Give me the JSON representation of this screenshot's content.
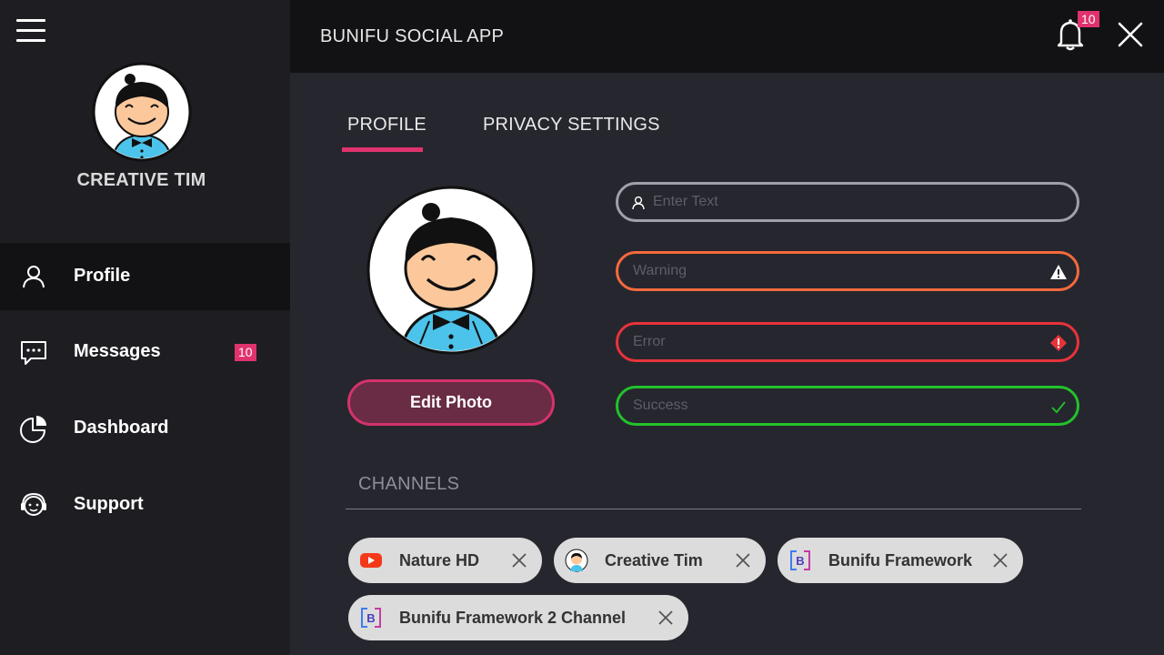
{
  "app": {
    "title": "BUNIFU SOCIAL APP"
  },
  "sidebar": {
    "username": "CREATIVE TIM",
    "items": [
      {
        "label": "Profile",
        "icon": "user-icon",
        "active": true
      },
      {
        "label": "Messages",
        "icon": "chat-icon",
        "badge": "10"
      },
      {
        "label": "Dashboard",
        "icon": "pie-chart-icon"
      },
      {
        "label": "Support",
        "icon": "support-icon"
      }
    ]
  },
  "header": {
    "notifications_badge": "10"
  },
  "tabs": [
    {
      "label": "PROFILE",
      "active": true
    },
    {
      "label": "PRIVACY SETTINGS",
      "active": false
    }
  ],
  "profile": {
    "edit_photo_label": "Edit Photo"
  },
  "form": {
    "default_placeholder": "Enter Text",
    "warning_placeholder": "Warning",
    "error_placeholder": "Error",
    "success_placeholder": "Success"
  },
  "channels": {
    "title": "CHANNELS",
    "items": [
      {
        "label": "Nature HD",
        "icon": "youtube-icon"
      },
      {
        "label": "Creative Tim",
        "icon": "avatar-icon"
      },
      {
        "label": "Bunifu Framework",
        "icon": "bunifu-logo-icon"
      },
      {
        "label": "Bunifu Framework 2 Channel",
        "icon": "bunifu-logo-icon"
      }
    ]
  },
  "colors": {
    "accent": "#e0336e",
    "warning": "#f46a3c",
    "error": "#e8333a",
    "success": "#22c22a",
    "sidebar": "#1d1d22",
    "main": "#26262f"
  }
}
